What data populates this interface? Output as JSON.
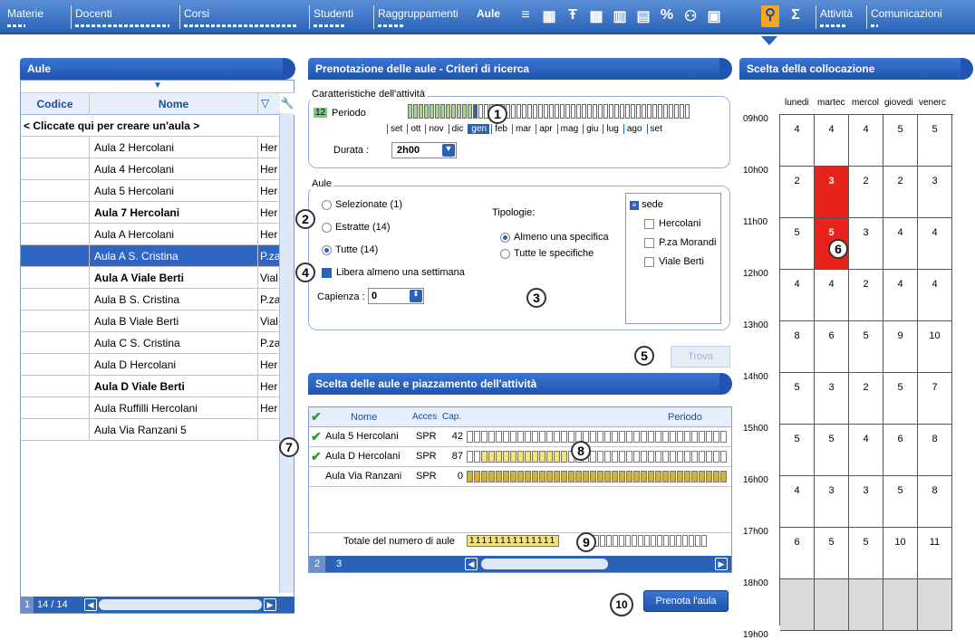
{
  "tabs": {
    "materie": "Materie",
    "docenti": "Docenti",
    "corsi": "Corsi",
    "studenti": "Studenti",
    "raggruppamenti": "Raggruppamenti",
    "aule": "Aule",
    "attivita": "Attività",
    "comunicazioni": "Comunicazioni",
    "sigma": "Σ",
    "percent": "%"
  },
  "left": {
    "title": "Aule",
    "col_codice": "Codice",
    "col_nome": "Nome",
    "create_row": "< Cliccate qui per creare un'aula >",
    "rows": [
      {
        "nome": "Aula 2 Hercolani",
        "sede": "Her"
      },
      {
        "nome": "Aula 4 Hercolani",
        "sede": "Her"
      },
      {
        "nome": "Aula 5 Hercolani",
        "sede": "Her"
      },
      {
        "nome": "Aula 7 Hercolani",
        "sede": "Her"
      },
      {
        "nome": "Aula A Hercolani",
        "sede": "Her"
      },
      {
        "nome": "Aula A S. Cristina",
        "sede": "P.za"
      },
      {
        "nome": "Aula A Viale Berti",
        "sede": "Vial"
      },
      {
        "nome": "Aula B S. Cristina",
        "sede": "P.za"
      },
      {
        "nome": "Aula B Viale Berti",
        "sede": "Vial"
      },
      {
        "nome": "Aula C S. Cristina",
        "sede": "P.za"
      },
      {
        "nome": "Aula D Hercolani",
        "sede": "Her"
      },
      {
        "nome": "Aula D Viale Berti",
        "sede": "Her"
      },
      {
        "nome": "Aula Ruffilli Hercolani",
        "sede": "Her"
      },
      {
        "nome": "Aula Via Ranzani 5",
        "sede": ""
      }
    ],
    "footer_page": "1",
    "footer_count": "14 / 14"
  },
  "search": {
    "title": "Prenotazione delle aule - Criteri di ricerca",
    "caratteristiche": "Caratteristiche dell'attività",
    "periodo_badge": "12",
    "periodo": "Periodo",
    "months": [
      "set",
      "ott",
      "nov",
      "dic",
      "gen",
      "feb",
      "mar",
      "apr",
      "mag",
      "giu",
      "lug",
      "ago",
      "set"
    ],
    "durata_label": "Durata :",
    "durata_value": "2h00",
    "aule_legend": "Aule",
    "sel": "Selezionate (1)",
    "estratte": "Estratte (14)",
    "tutte": "Tutte (14)",
    "libera": "Libera almeno una settimana",
    "capienza_label": "Capienza :",
    "capienza_value": "0",
    "tipologie": "Tipologie:",
    "almeno": "Almeno una specifica",
    "tutte_spec": "Tutte le specifiche",
    "sede": "sede",
    "sedi": [
      "Hercolani",
      "P.za Morandi",
      "Viale Berti"
    ],
    "trova": "Trova"
  },
  "placement": {
    "title": "Scelta delle aule e piazzamento dell'attività",
    "h_nome": "Nome",
    "h_acces": "Acces",
    "h_cap": "Cap.",
    "h_periodo": "Periodo",
    "rows": [
      {
        "nome": "Aula 5 Hercolani",
        "acces": "SPR",
        "cap": "42"
      },
      {
        "nome": "Aula D Hercolani",
        "acces": "SPR",
        "cap": "87"
      },
      {
        "nome": "Aula Via Ranzani",
        "acces": "SPR",
        "cap": "0"
      }
    ],
    "totale": "Totale del numero di aule",
    "totale_digits": "11111111111111",
    "page": "2",
    "page2": "3",
    "prenota": "Prenota l'aula"
  },
  "cal": {
    "title": "Scelta della collocazione",
    "days": [
      "lunedi",
      "martec",
      "mercol",
      "giovedi",
      "venerc"
    ],
    "hours": [
      "09h00",
      "10h00",
      "11h00",
      "12h00",
      "13h00",
      "14h00",
      "15h00",
      "16h00",
      "17h00",
      "18h00",
      "19h00"
    ],
    "rows": [
      [
        "4",
        "4",
        "4",
        "5",
        "5"
      ],
      [
        "2",
        "3",
        "2",
        "2",
        "3"
      ],
      [
        "5",
        "5",
        "3",
        "4",
        "4"
      ],
      [
        "4",
        "4",
        "2",
        "4",
        "4"
      ],
      [
        "8",
        "6",
        "5",
        "9",
        "10"
      ],
      [
        "5",
        "3",
        "2",
        "5",
        "7"
      ],
      [
        "5",
        "5",
        "4",
        "6",
        "8"
      ],
      [
        "4",
        "3",
        "3",
        "5",
        "8"
      ],
      [
        "6",
        "5",
        "5",
        "10",
        "11"
      ]
    ]
  },
  "markers": [
    "1",
    "2",
    "3",
    "4",
    "5",
    "6",
    "7",
    "8",
    "9",
    "10"
  ]
}
